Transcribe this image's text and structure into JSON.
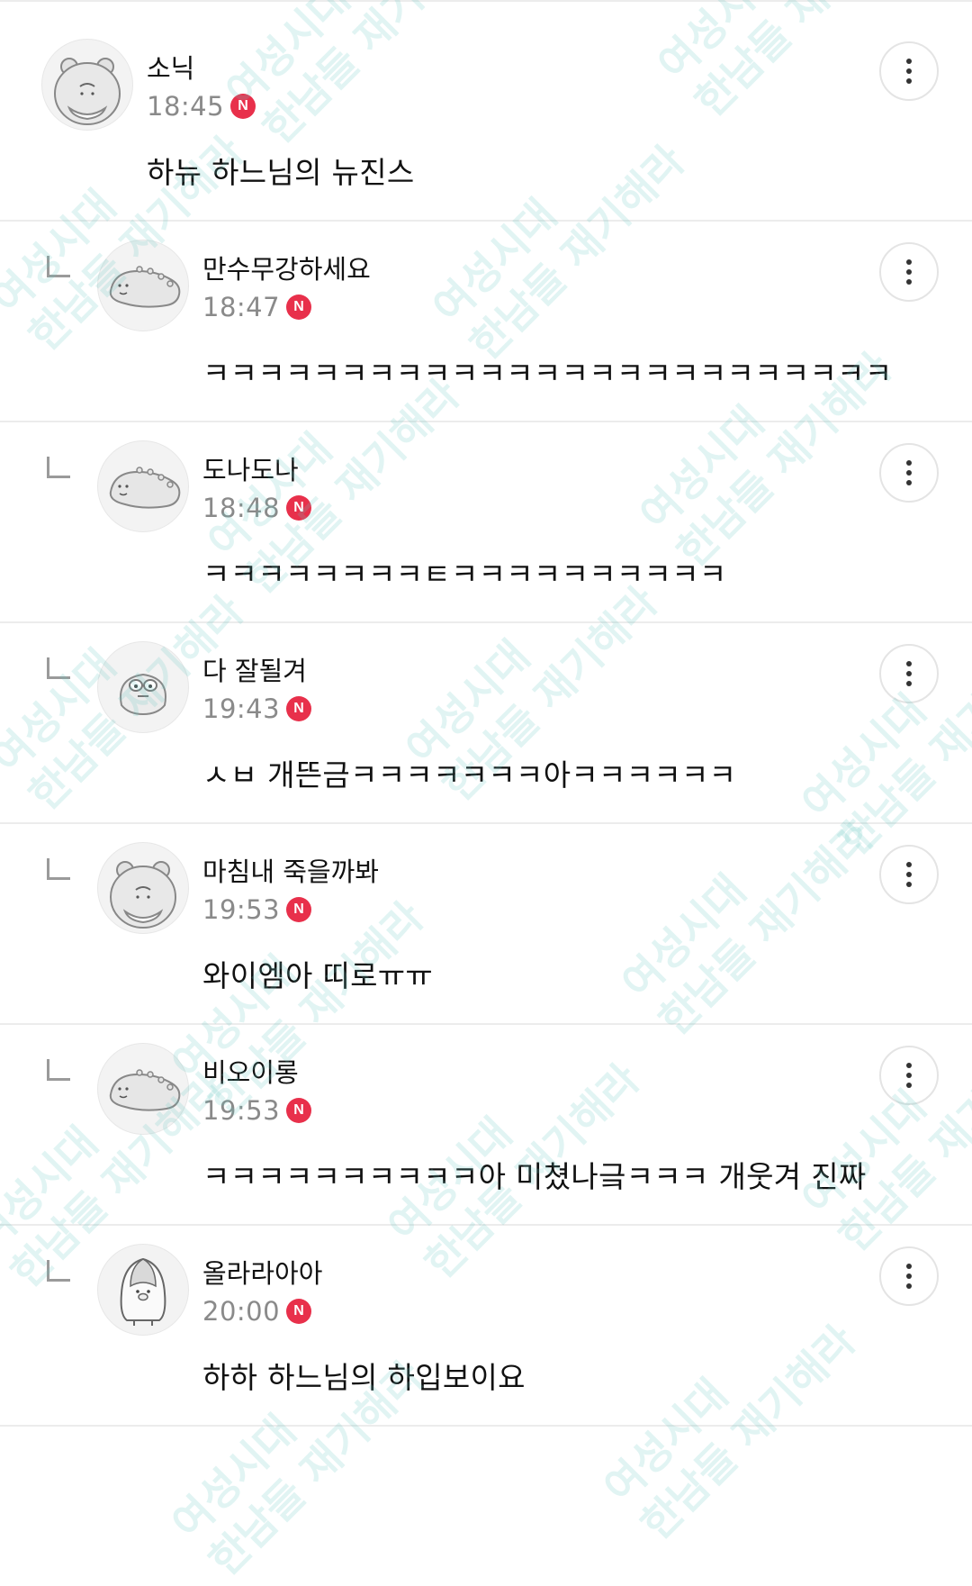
{
  "badge_letter": "N",
  "badge_color": "#e8304b",
  "watermark": {
    "line1": "여성시대",
    "line2": "한남들 재기해라"
  },
  "comments": [
    {
      "nickname": "소닉",
      "time": "18:45",
      "text": "하뉴 하느님의 뉴진스",
      "is_reply": false,
      "avatar": "hamster-icon"
    },
    {
      "nickname": "만수무강하세요",
      "time": "18:47",
      "text": "ㅋㅋㅋㅋㅋㅋㅋㅋㅋㅋㅋㅋㅋㅋㅋㅋㅋㅋㅋㅋㅋㅋㅋㅋㅋ",
      "is_reply": true,
      "avatar": "dino-icon"
    },
    {
      "nickname": "도나도나",
      "time": "18:48",
      "text": "ㅋㅋㅋㅋㅋㅋㅋㅋㅌㅋㅋㅋㅋㅋㅋㅋㅋㅋㅋ",
      "is_reply": true,
      "avatar": "dino-icon"
    },
    {
      "nickname": "다 잘될겨",
      "time": "19:43",
      "text": "ㅅㅂ 개뜬금ㅋㅋㅋㅋㅋㅋㅋ아ㅋㅋㅋㅋㅋㅋ",
      "is_reply": true,
      "avatar": "blob-icon"
    },
    {
      "nickname": "마침내 죽을까봐",
      "time": "19:53",
      "text": "와이엠아 띠로ㅠㅠ",
      "is_reply": true,
      "avatar": "hamster-icon"
    },
    {
      "nickname": "비오이롱",
      "time": "19:53",
      "text": "ㅋㅋㅋㅋㅋㅋㅋㅋㅋㅋ아 미쳤나긐ㅋㅋㅋ 개웃겨 진짜",
      "is_reply": true,
      "avatar": "dino-icon"
    },
    {
      "nickname": "올라라아아",
      "time": "20:00",
      "text": "하하 하느님의 하입보이요",
      "is_reply": true,
      "avatar": "penguin-icon"
    }
  ]
}
